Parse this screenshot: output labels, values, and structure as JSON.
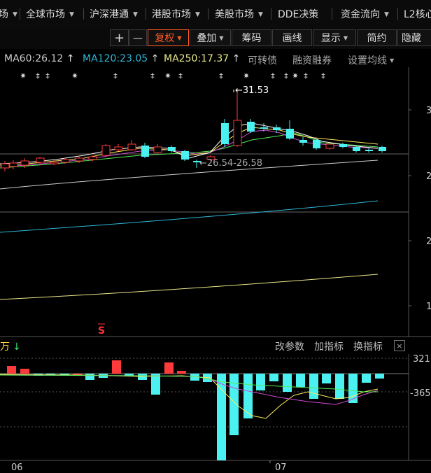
{
  "top_menu": {
    "items": [
      {
        "label": "场",
        "caret": true
      },
      {
        "label": "全球市场",
        "caret": true
      },
      {
        "label": "沪深港通",
        "caret": true
      },
      {
        "label": "港股市场",
        "caret": true
      },
      {
        "label": "美股市场",
        "caret": true
      },
      {
        "label": "DDE决策",
        "caret": false
      },
      {
        "label": "资金流向",
        "caret": true
      },
      {
        "label": "L2核心",
        "caret": false
      }
    ]
  },
  "toolbar": {
    "plus": "+",
    "minus": "—",
    "fuquan": "复权",
    "diejia": "叠加",
    "chouma": "筹码",
    "huaxian": "画线",
    "xianshi": "显示",
    "jianyue": "简约",
    "yincang": "隐藏"
  },
  "ma_bar": {
    "ma60": "MA60:26.12",
    "ma120": "MA120:23.05",
    "ma250": "MA250:17.37",
    "convert_bond": "可转债",
    "margin": "融资融券",
    "set_ma": "设置均线"
  },
  "colors": {
    "up": "#ff3a3a",
    "down": "#4bf0f0",
    "ma5": "#ffffff",
    "ma10": "#ffe95a",
    "ma20": "#d04bd0",
    "ma30": "#55ee55",
    "ma60": "#cccccc",
    "ma120": "#2fb7d8",
    "ma250": "#e8e88a",
    "accent": "#ff5a24"
  },
  "chart_data": {
    "type": "candlestick",
    "high_annotation": "31.53",
    "range_annotation": "26.54-26.58",
    "y_tick_labels": [
      "3",
      "2",
      "2",
      "1"
    ],
    "event_marker": "S",
    "date_labels": [
      "06",
      "07"
    ]
  },
  "indicator": {
    "title": "万",
    "arrow": "↓",
    "btn_params": "改参数",
    "btn_add": "加指标",
    "btn_switch": "换指标",
    "close": "×",
    "y_labels": [
      "321",
      "-365"
    ]
  }
}
